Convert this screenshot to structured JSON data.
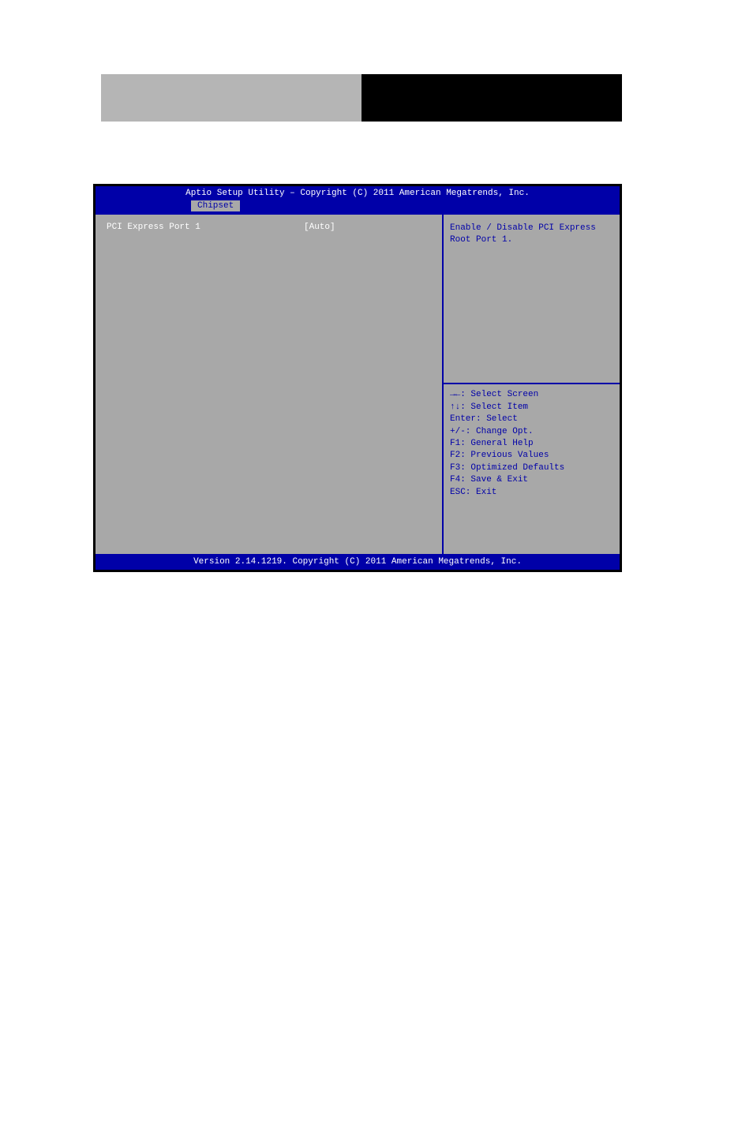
{
  "header": {
    "present": true
  },
  "bios": {
    "title": "Aptio Setup Utility – Copyright (C) 2011 American Megatrends, Inc.",
    "active_tab": "Chipset",
    "setting": {
      "label": "PCI Express Port 1",
      "value": "[Auto]"
    },
    "help_text_line1": "Enable / Disable PCI Express",
    "help_text_line2": "Root Port 1.",
    "hints": {
      "select_screen": "→←: Select Screen",
      "select_item": "↑↓: Select Item",
      "enter": "Enter: Select",
      "change": "+/-: Change Opt.",
      "f1": "F1: General Help",
      "f2": "F2: Previous Values",
      "f3": "F3: Optimized Defaults",
      "f4": "F4: Save & Exit",
      "esc": "ESC: Exit"
    },
    "footer": "Version 2.14.1219. Copyright (C) 2011 American Megatrends, Inc."
  }
}
